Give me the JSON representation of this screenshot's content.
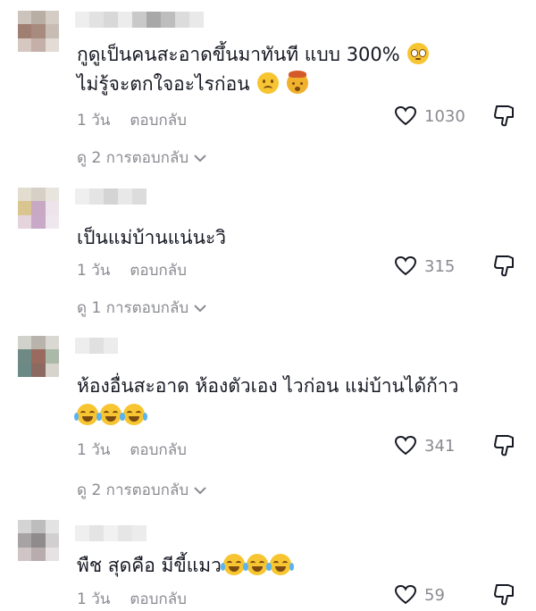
{
  "comments": [
    {
      "text_line1": "กูดูเป็นคนสะอาดขึ้นมาทันที แบบ 300%",
      "text_line2": "ไม่รู้จะตกใจอะไรก่อน",
      "time": "1 วัน",
      "reply_label": "ตอบกลับ",
      "likes": "1030",
      "view_replies": "ดู 2 การตอบกลับ",
      "emojis_line1": [
        "flushed-face"
      ],
      "emojis_line2": [
        "worried-face",
        "exploding-head"
      ]
    },
    {
      "text_line1": "เป็นแม่บ้านแน่นะวิ",
      "time": "1 วัน",
      "reply_label": "ตอบกลับ",
      "likes": "315",
      "view_replies": "ดู 1 การตอบกลับ"
    },
    {
      "text_line1": "ห้องอื่นสะอาด ห้องตัวเอง ไวก่อน แม่บ้านได้ก้าว",
      "time": "1 วัน",
      "reply_label": "ตอบกลับ",
      "likes": "341",
      "view_replies": "ดู 2 การตอบกลับ",
      "emojis_line2": [
        "tears-of-joy",
        "tears-of-joy",
        "tears-of-joy"
      ]
    },
    {
      "text_line1": "พืช สุดคือ มีขี้แมว",
      "time": "1 วัน",
      "reply_label": "ตอบกลับ",
      "likes": "59",
      "emojis_line1": [
        "tears-of-joy",
        "tears-of-joy",
        "tears-of-joy"
      ]
    }
  ],
  "colors": {
    "text": "#161823",
    "muted": "#8a8b91",
    "emoji": "#f7c531"
  }
}
